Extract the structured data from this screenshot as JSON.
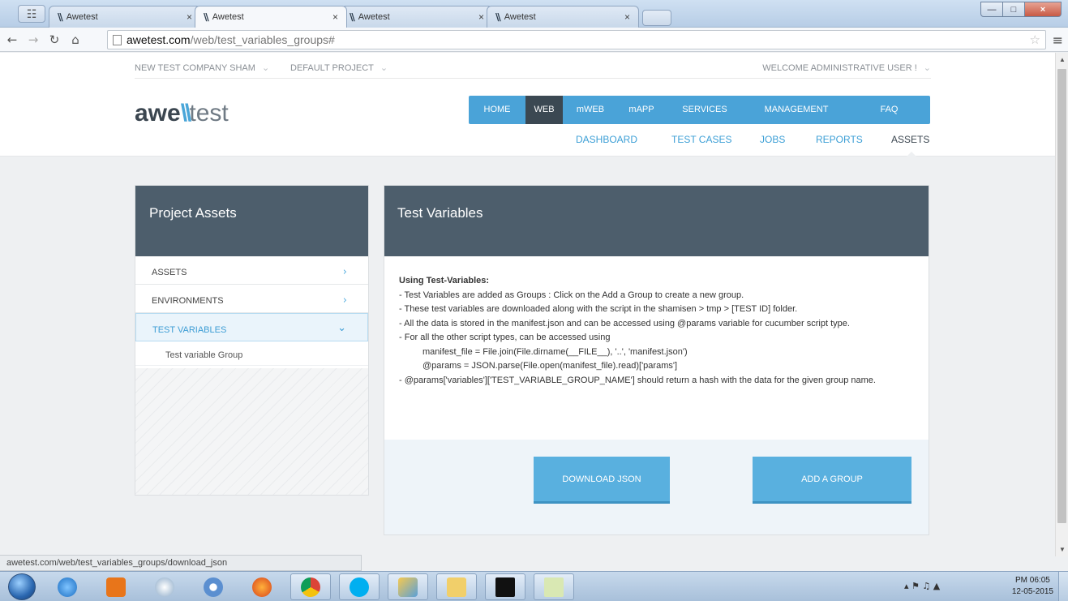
{
  "browser": {
    "tabs": [
      {
        "title": "Awetest",
        "active": false
      },
      {
        "title": "Awetest",
        "active": true
      },
      {
        "title": "Awetest",
        "active": false
      },
      {
        "title": "Awetest",
        "active": false
      }
    ],
    "url_host": "awetest.com",
    "url_path": "/web/test_variables_groups#",
    "status_url": "awetest.com/web/test_variables_groups/download_json"
  },
  "header": {
    "company": "NEW TEST COMPANY SHAM",
    "project": "DEFAULT PROJECT",
    "welcome": "WELCOME ADMINISTRATIVE USER !",
    "logo_a": "awe",
    "logo_slashes": "\\\\",
    "logo_b": "test"
  },
  "main_nav": {
    "items": [
      {
        "label": "HOME",
        "active": false
      },
      {
        "label": "WEB",
        "active": true
      },
      {
        "label": "mWEB",
        "active": false
      },
      {
        "label": "mAPP",
        "active": false
      },
      {
        "label": "SERVICES",
        "active": false
      },
      {
        "label": "MANAGEMENT",
        "active": false
      },
      {
        "label": "FAQ",
        "active": false
      }
    ]
  },
  "sub_nav": {
    "items": [
      {
        "label": "DASHBOARD",
        "active": false
      },
      {
        "label": "TEST CASES",
        "active": false
      },
      {
        "label": "JOBS",
        "active": false
      },
      {
        "label": "REPORTS",
        "active": false
      },
      {
        "label": "ASSETS",
        "active": true
      }
    ]
  },
  "sidebar": {
    "title": "Project Assets",
    "items": [
      {
        "label": "ASSETS",
        "active": false
      },
      {
        "label": "ENVIRONMENTS",
        "active": false
      },
      {
        "label": "TEST VARIABLES",
        "active": true
      }
    ],
    "sub_items": [
      {
        "label": "Test variable Group"
      }
    ]
  },
  "content": {
    "title": "Test Variables",
    "info_title": "Using Test-Variables:",
    "lines": [
      "- Test Variables are added as Groups : Click on the Add a Group to create a new group.",
      "- These test variables are downloaded along with the script in the shamisen > tmp > [TEST ID] folder.",
      "- All the data is stored in the manifest.json and can be accessed using @params variable for cucumber script type.",
      "- For all the other script types, can be accessed using"
    ],
    "code_lines": [
      "manifest_file = File.join(File.dirname(__FILE__), '..', 'manifest.json')",
      "@params = JSON.parse(File.open(manifest_file).read)['params']"
    ],
    "last_line": "- @params['variables']['TEST_VARIABLE_GROUP_NAME'] should return a hash with the data for the given group name.",
    "download_button": "DOWNLOAD JSON",
    "add_group_button": "ADD A GROUP"
  },
  "taskbar": {
    "time": "PM 06:05",
    "date": "12-05-2015"
  },
  "colors": {
    "accent": "#4aa3d8",
    "panel_header": "#4d5e6c",
    "nav_active": "#3b4852"
  }
}
